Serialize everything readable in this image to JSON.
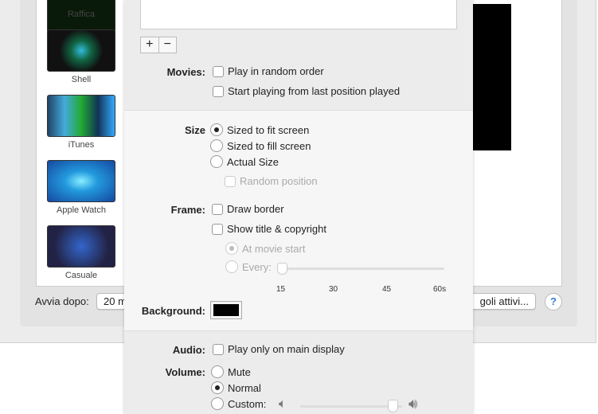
{
  "screensavers": [
    {
      "label": "Raffica"
    },
    {
      "label": "Shell"
    },
    {
      "label": "iTunes"
    },
    {
      "label": "Apple Watch"
    },
    {
      "label": "Casuale"
    }
  ],
  "start_after": {
    "label": "Avvia dopo:",
    "value": "20 m"
  },
  "hot_corners_button": "goli attivi...",
  "help": "?",
  "sheet": {
    "add": "+",
    "remove": "−",
    "movies": {
      "label": "Movies:",
      "random": "Play in random order",
      "resume": "Start playing from last position played"
    },
    "size": {
      "label": "Size",
      "fit": "Sized to fit screen",
      "fill": "Sized to fill screen",
      "actual": "Actual Size",
      "random_pos": "Random position"
    },
    "frame": {
      "label": "Frame:",
      "border": "Draw border",
      "title": "Show title & copyright",
      "at_start": "At movie start",
      "every": "Every:",
      "ticks": [
        "15",
        "30",
        "45",
        "60s"
      ],
      "slider_value": 15
    },
    "background": {
      "label": "Background:",
      "color": "#000000"
    },
    "audio": {
      "label": "Audio:",
      "main_only": "Play only on main display"
    },
    "volume": {
      "label": "Volume:",
      "mute": "Mute",
      "normal": "Normal",
      "custom": "Custom:",
      "level": 0.85
    }
  }
}
